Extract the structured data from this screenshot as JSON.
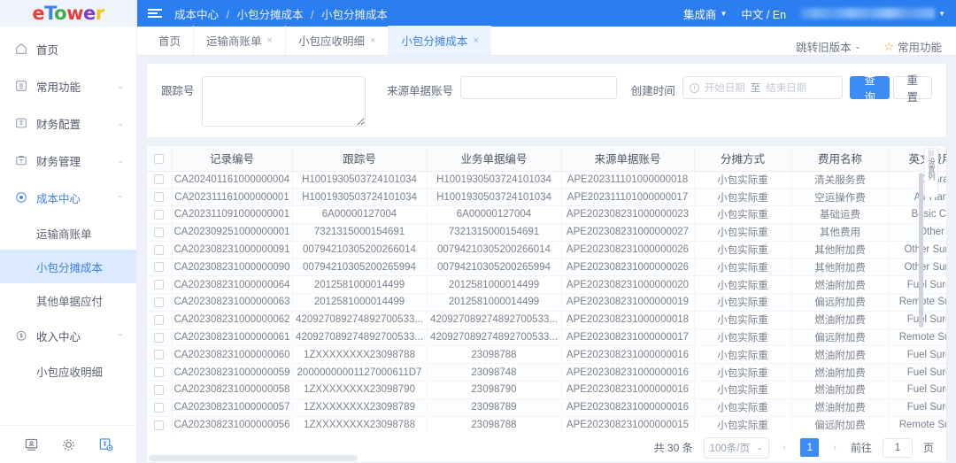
{
  "brand": {
    "logo_text": "eTower",
    "letters": [
      "e",
      "T",
      "o",
      "w",
      "e",
      "r"
    ]
  },
  "sidebar": {
    "items": [
      {
        "label": "首页",
        "icon": "home-icon",
        "expandable": false
      },
      {
        "label": "常用功能",
        "icon": "star-box-icon",
        "expandable": true
      },
      {
        "label": "财务配置",
        "icon": "finance-config-icon",
        "expandable": true
      },
      {
        "label": "财务管理",
        "icon": "finance-manage-icon",
        "expandable": true
      },
      {
        "label": "成本中心",
        "icon": "cost-center-icon",
        "expandable": true,
        "active": true
      }
    ],
    "cost_center_children": [
      {
        "label": "运输商账单",
        "selected": false
      },
      {
        "label": "小包分摊成本",
        "selected": true
      },
      {
        "label": "其他单据应付",
        "selected": false
      }
    ],
    "income_center": {
      "label": "收入中心",
      "icon": "income-center-icon",
      "expandable": true
    },
    "income_children": [
      {
        "label": "小包应收明细",
        "selected": false
      }
    ],
    "footer_icons": [
      "monitor-user-icon",
      "gear-icon",
      "currency-settings-icon"
    ]
  },
  "topbar": {
    "menu_icon": "hamburger-icon",
    "breadcrumb": [
      "成本中心",
      "小包分摊成本",
      "小包分摊成本"
    ],
    "separator": "/",
    "integrator_label": "集成商",
    "language_label": "中文 / En",
    "user_label": ""
  },
  "tabs": {
    "items": [
      {
        "label": "首页",
        "closable": false,
        "active": false
      },
      {
        "label": "运输商账单",
        "closable": true,
        "active": false
      },
      {
        "label": "小包应收明细",
        "closable": true,
        "active": false
      },
      {
        "label": "小包分摊成本",
        "closable": true,
        "active": true
      }
    ],
    "close_glyph": "×",
    "legacy_label": "跳转旧版本",
    "favorites_label": "常用功能",
    "star_glyph": "☆"
  },
  "filters": {
    "tracking_no_label": "跟踪号",
    "tracking_no_value": "",
    "source_acct_label": "来源单据账号",
    "source_acct_value": "",
    "create_time_label": "创建时间",
    "date_start_placeholder": "开始日期",
    "date_sep": "至",
    "date_end_placeholder": "结束日期",
    "search_button": "查询",
    "reset_button": "重置"
  },
  "table": {
    "columns": [
      "记录编号",
      "跟踪号",
      "业务单据编号",
      "来源单据账号",
      "分摊方式",
      "费用名称",
      "英文费用名称"
    ],
    "column_config_label": "设置列",
    "rows": [
      {
        "record_no": "CA202401161000000004",
        "tracking_no": "H1001930503724101034",
        "biz_no": "H1001930503724101034",
        "source_acct": "APE202311101000000018",
        "alloc": "小包实际重",
        "fee_cn": "清关服务费",
        "fee_en": "Clearance"
      },
      {
        "record_no": "CA202311161000000001",
        "tracking_no": "H1001930503724101034",
        "biz_no": "H1001930503724101034",
        "source_acct": "APE202311101000000017",
        "alloc": "小包实际重",
        "fee_cn": "空运操作费",
        "fee_en": "Air Handling"
      },
      {
        "record_no": "CA202311091000000001",
        "tracking_no": "6A00000127004",
        "biz_no": "6A00000127004",
        "source_acct": "APE202308231000000023",
        "alloc": "小包实际重",
        "fee_cn": "基础运费",
        "fee_en": "Basic Charge"
      },
      {
        "record_no": "CA202309251000000001",
        "tracking_no": "7321315000154691",
        "biz_no": "7321315000154691",
        "source_acct": "APE202308231000000027",
        "alloc": "小包实际重",
        "fee_cn": "其他费用",
        "fee_en": "Other Fee"
      },
      {
        "record_no": "CA202308231000000091",
        "tracking_no": "00794210305200266014",
        "biz_no": "00794210305200266014",
        "source_acct": "APE202308231000000026",
        "alloc": "小包实际重",
        "fee_cn": "其他附加费",
        "fee_en": "Other Surcharge"
      },
      {
        "record_no": "CA202308231000000090",
        "tracking_no": "00794210305200265994",
        "biz_no": "00794210305200265994",
        "source_acct": "APE202308231000000026",
        "alloc": "小包实际重",
        "fee_cn": "其他附加费",
        "fee_en": "Other Surcharge"
      },
      {
        "record_no": "CA202308231000000064",
        "tracking_no": "2012581000014499",
        "biz_no": "2012581000014499",
        "source_acct": "APE202308231000000020",
        "alloc": "小包实际重",
        "fee_cn": "燃油附加费",
        "fee_en": "Fuel Surcharge"
      },
      {
        "record_no": "CA202308231000000063",
        "tracking_no": "2012581000014499",
        "biz_no": "2012581000014499",
        "source_acct": "APE202308231000000019",
        "alloc": "小包实际重",
        "fee_cn": "偏远附加费",
        "fee_en": "Remote Surcharge"
      },
      {
        "record_no": "CA202308231000000062",
        "tracking_no": "420927089274892700533...",
        "biz_no": "420927089274892700533...",
        "source_acct": "APE202308231000000018",
        "alloc": "小包实际重",
        "fee_cn": "燃油附加费",
        "fee_en": "Fuel Surcharge"
      },
      {
        "record_no": "CA202308231000000061",
        "tracking_no": "420927089274892700533...",
        "biz_no": "420927089274892700533...",
        "source_acct": "APE202308231000000017",
        "alloc": "小包实际重",
        "fee_cn": "偏远附加费",
        "fee_en": "Remote Surcharge"
      },
      {
        "record_no": "CA202308231000000060",
        "tracking_no": "1ZXXXXXXXX23098788",
        "biz_no": "23098788",
        "source_acct": "APE202308231000000016",
        "alloc": "小包实际重",
        "fee_cn": "燃油附加费",
        "fee_en": "Fuel Surcharge"
      },
      {
        "record_no": "CA202308231000000059",
        "tracking_no": "20000000001127000611D7",
        "biz_no": "23098748",
        "source_acct": "APE202308231000000016",
        "alloc": "小包实际重",
        "fee_cn": "燃油附加费",
        "fee_en": "Fuel Surcharge"
      },
      {
        "record_no": "CA202308231000000058",
        "tracking_no": "1ZXXXXXXXX23098790",
        "biz_no": "23098790",
        "source_acct": "APE202308231000000016",
        "alloc": "小包实际重",
        "fee_cn": "燃油附加费",
        "fee_en": "Fuel Surcharge"
      },
      {
        "record_no": "CA202308231000000057",
        "tracking_no": "1ZXXXXXXXX23098789",
        "biz_no": "23098789",
        "source_acct": "APE202308231000000016",
        "alloc": "小包实际重",
        "fee_cn": "燃油附加费",
        "fee_en": "Fuel Surcharge"
      },
      {
        "record_no": "CA202308231000000056",
        "tracking_no": "1ZXXXXXXXX23098788",
        "biz_no": "23098788",
        "source_acct": "APE202308231000000015",
        "alloc": "小包实际重",
        "fee_cn": "偏远附加费",
        "fee_en": "Remote Surcharge"
      }
    ]
  },
  "pagination": {
    "total_text": "共 30 条",
    "page_size": "100条/页",
    "prev_glyph": "‹",
    "next_glyph": "›",
    "current_page": "1",
    "goto_label": "前往",
    "goto_value": "1",
    "page_unit": "页"
  },
  "colors": {
    "accent": "#3c8cf5",
    "topbar": "#2a7ef0",
    "selected_nav": "#dbeafe"
  }
}
